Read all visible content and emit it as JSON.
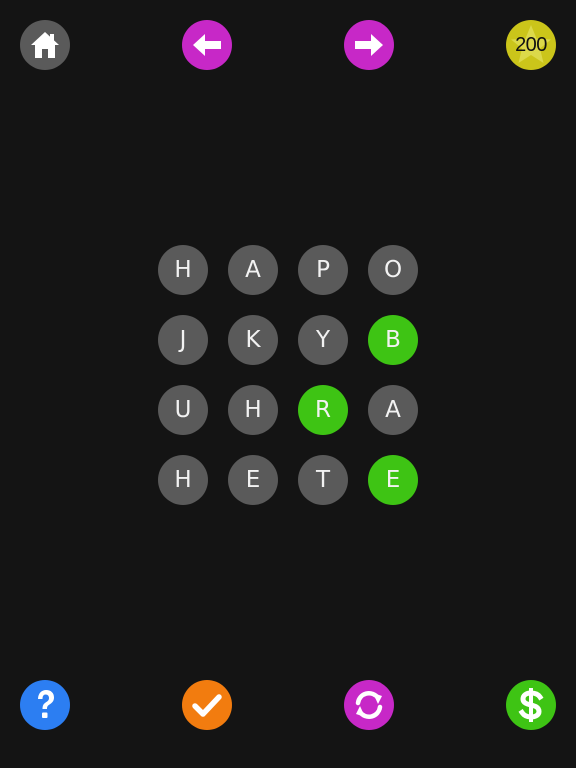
{
  "toolbar": {
    "home": {
      "icon": "home-icon",
      "color": "#5a5a5a"
    },
    "back": {
      "icon": "arrow-left-icon",
      "color": "#c728c7"
    },
    "forward": {
      "icon": "arrow-right-icon",
      "color": "#c728c7"
    },
    "coins": {
      "icon": "star-icon",
      "value": "200",
      "color": "#cbc51a"
    }
  },
  "board": {
    "tiles": [
      {
        "letter": "H",
        "selected": false
      },
      {
        "letter": "A",
        "selected": false
      },
      {
        "letter": "P",
        "selected": false
      },
      {
        "letter": "O",
        "selected": false
      },
      {
        "letter": "J",
        "selected": false
      },
      {
        "letter": "K",
        "selected": false
      },
      {
        "letter": "Y",
        "selected": false
      },
      {
        "letter": "B",
        "selected": true
      },
      {
        "letter": "U",
        "selected": false
      },
      {
        "letter": "H",
        "selected": false
      },
      {
        "letter": "R",
        "selected": true
      },
      {
        "letter": "A",
        "selected": false
      },
      {
        "letter": "H",
        "selected": false
      },
      {
        "letter": "E",
        "selected": false
      },
      {
        "letter": "T",
        "selected": false
      },
      {
        "letter": "E",
        "selected": true
      }
    ],
    "tile_color": "#5a5a5a",
    "selected_color": "#3ec414"
  },
  "bottom_bar": {
    "help": {
      "icon": "question-icon",
      "color": "#2c7ef2"
    },
    "submit": {
      "icon": "checkmark-icon",
      "color": "#f27c0f"
    },
    "shuffle": {
      "icon": "refresh-icon",
      "color": "#c728c7"
    },
    "buy": {
      "icon": "dollar-icon",
      "color": "#3ec414"
    }
  }
}
